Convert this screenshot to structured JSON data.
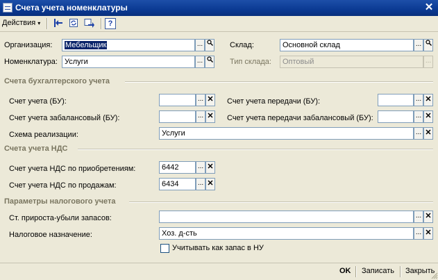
{
  "window": {
    "title": "Счета учета номенклатуры",
    "close": "✕"
  },
  "toolbar": {
    "actions_menu": "Действия",
    "menu_arrow": "▾"
  },
  "fields": {
    "organization": {
      "label": "Организация:",
      "value": "Мебельщик"
    },
    "warehouse": {
      "label": "Склад:",
      "value": "Основной склад"
    },
    "nomenclature": {
      "label": "Номенклатура:",
      "value": "Услуги"
    },
    "warehouse_type": {
      "label": "Тип склада:",
      "value": "Оптовый"
    }
  },
  "sections": {
    "accounting": {
      "title": "Счета бухгалтерского учета",
      "account": {
        "label": "Счет учета (БУ):",
        "value": ""
      },
      "transfer_account": {
        "label": "Счет учета передачи (БУ):",
        "value": ""
      },
      "offbalance_account": {
        "label": "Счет учета забалансовый (БУ):",
        "value": ""
      },
      "transfer_offbalance_account": {
        "label": "Счет учета передачи забалансовый (БУ):",
        "value": ""
      },
      "sales_scheme": {
        "label": "Схема реализации:",
        "value": "Услуги"
      }
    },
    "vat": {
      "title": "Счета учета НДС",
      "purchase": {
        "label": "Счет учета НДС по приобретениям:",
        "value": "6442"
      },
      "sales": {
        "label": "Счет учета НДС по продажам:",
        "value": "6434"
      }
    },
    "tax": {
      "title": "Параметры налогового учета",
      "inventory_change": {
        "label": "Ст. прироста-убыли запасов:",
        "value": ""
      },
      "tax_purpose": {
        "label": "Налоговое назначение:",
        "value": "Хоз. д-сть"
      },
      "stock_checkbox": {
        "label": "Учитывать как запас в НУ",
        "checked": false
      }
    }
  },
  "buttons": {
    "ellipsis": "...",
    "clear": "✕",
    "ok": "OK",
    "save": "Записать",
    "close": "Закрыть"
  }
}
